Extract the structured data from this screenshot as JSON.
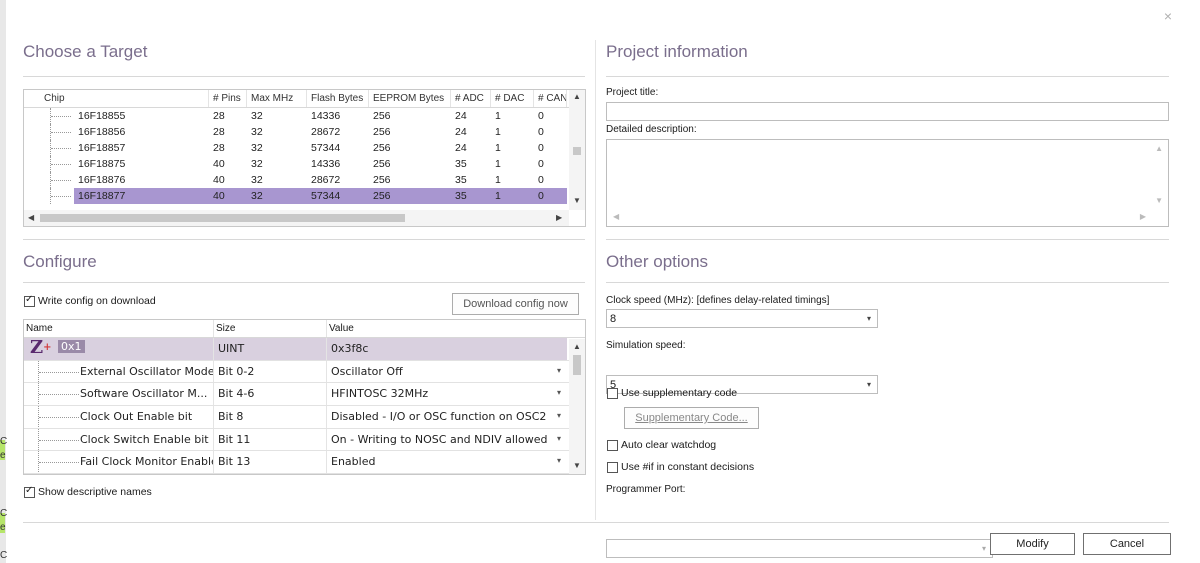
{
  "window": {
    "close_glyph": "×"
  },
  "left_edge": {
    "chars": [
      "C",
      "e",
      "C",
      "e",
      "C"
    ]
  },
  "target": {
    "title": "Choose a Target",
    "columns": [
      "Chip",
      "# Pins",
      "Max MHz",
      "Flash Bytes",
      "EEPROM Bytes",
      "# ADC",
      "# DAC",
      "# CAN"
    ],
    "rows": [
      {
        "chip": "16F18855",
        "pins": "28",
        "mhz": "32",
        "flash": "14336",
        "eeprom": "256",
        "adc": "24",
        "dac": "1",
        "can": "0"
      },
      {
        "chip": "16F18856",
        "pins": "28",
        "mhz": "32",
        "flash": "28672",
        "eeprom": "256",
        "adc": "24",
        "dac": "1",
        "can": "0"
      },
      {
        "chip": "16F18857",
        "pins": "28",
        "mhz": "32",
        "flash": "57344",
        "eeprom": "256",
        "adc": "24",
        "dac": "1",
        "can": "0"
      },
      {
        "chip": "16F18875",
        "pins": "40",
        "mhz": "32",
        "flash": "14336",
        "eeprom": "256",
        "adc": "35",
        "dac": "1",
        "can": "0"
      },
      {
        "chip": "16F18876",
        "pins": "40",
        "mhz": "32",
        "flash": "28672",
        "eeprom": "256",
        "adc": "35",
        "dac": "1",
        "can": "0"
      },
      {
        "chip": "16F18877",
        "pins": "40",
        "mhz": "32",
        "flash": "57344",
        "eeprom": "256",
        "adc": "35",
        "dac": "1",
        "can": "0"
      }
    ],
    "selected_index": 5
  },
  "configure": {
    "title": "Configure",
    "write_config_label": "Write config on download",
    "write_config_checked": true,
    "download_button": "Download config now",
    "columns": [
      "Name",
      "Size",
      "Value"
    ],
    "top_row": {
      "name": "0x1",
      "size": "UINT",
      "value": "0x3f8c"
    },
    "rows": [
      {
        "name": "External Oscillator Mode",
        "size": "Bit 0-2",
        "value": "Oscillator Off"
      },
      {
        "name": "Software Oscillator M...",
        "size": "Bit 4-6",
        "value": "HFINTOSC 32MHz"
      },
      {
        "name": "Clock Out Enable bit",
        "size": "Bit 8",
        "value": "Disabled - I/O or OSC function on OSC2"
      },
      {
        "name": "Clock Switch Enable bit",
        "size": "Bit 11",
        "value": "On - Writing to NOSC and NDIV allowed"
      },
      {
        "name": "Fail Clock Monitor Enable",
        "size": "Bit 13",
        "value": "Enabled"
      }
    ],
    "show_descriptive_label": "Show descriptive names",
    "show_descriptive_checked": true
  },
  "project": {
    "title": "Project information",
    "project_title_label": "Project title:",
    "project_title_value": "",
    "description_label": "Detailed description:",
    "description_value": ""
  },
  "options": {
    "title": "Other options",
    "clock_label": "Clock speed (MHz): [defines delay-related timings]",
    "clock_value": "8",
    "sim_label": "Simulation speed:",
    "sim_value": "5",
    "supp_label": "Use supplementary code",
    "supp_checked": false,
    "supp_button": "Supplementary Code...",
    "watchdog_label": "Auto clear watchdog",
    "watchdog_checked": false,
    "ifdef_label": "Use #if in constant decisions",
    "ifdef_checked": false,
    "port_label": "Programmer Port:",
    "port_value": ""
  },
  "footer": {
    "modify": "Modify",
    "cancel": "Cancel"
  },
  "colors": {
    "accent_title": "#7a6e8c",
    "selection": "#a896d0",
    "config_top": "#d9d0df"
  },
  "icons": {
    "z_logo": "flowcode-z-icon"
  }
}
